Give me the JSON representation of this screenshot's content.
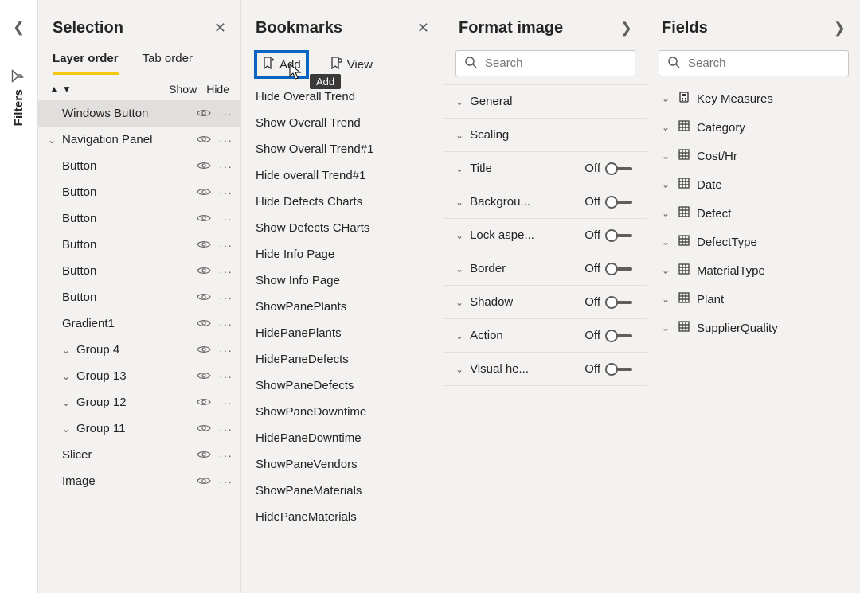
{
  "filters": {
    "label": "Filters"
  },
  "selection": {
    "title": "Selection",
    "tabs": {
      "layer": "Layer order",
      "tab": "Tab order"
    },
    "subhead": {
      "show": "Show",
      "hide": "Hide"
    },
    "items": [
      {
        "label": "Windows Button",
        "indent": 0,
        "chev": false,
        "highlight": true
      },
      {
        "label": "Navigation Panel",
        "indent": 0,
        "chev": true
      },
      {
        "label": "Button",
        "indent": 0,
        "chev": false
      },
      {
        "label": "Button",
        "indent": 0,
        "chev": false
      },
      {
        "label": "Button",
        "indent": 0,
        "chev": false
      },
      {
        "label": "Button",
        "indent": 0,
        "chev": false
      },
      {
        "label": "Button",
        "indent": 0,
        "chev": false
      },
      {
        "label": "Button",
        "indent": 0,
        "chev": false
      },
      {
        "label": "Gradient1",
        "indent": 0,
        "chev": false
      },
      {
        "label": "Group 4",
        "indent": 0,
        "chev": true,
        "indent1": true
      },
      {
        "label": "Group 13",
        "indent": 0,
        "chev": true,
        "indent1": true
      },
      {
        "label": "Group 12",
        "indent": 0,
        "chev": true,
        "indent1": true
      },
      {
        "label": "Group 11",
        "indent": 0,
        "chev": true,
        "indent1": true
      },
      {
        "label": "Slicer",
        "indent": 0,
        "chev": false
      },
      {
        "label": "Image",
        "indent": 0,
        "chev": false
      }
    ]
  },
  "bookmarks": {
    "title": "Bookmarks",
    "add": "Add",
    "view": "View",
    "tooltip": "Add",
    "items": [
      "Hide Overall Trend",
      "Show Overall Trend",
      "Show Overall Trend#1",
      "Hide overall Trend#1",
      "Hide Defects Charts",
      "Show Defects CHarts",
      "Hide Info Page",
      "Show Info Page",
      "ShowPanePlants",
      "HidePanePlants",
      "HidePaneDefects",
      "ShowPaneDefects",
      "ShowPaneDowntime",
      "HidePaneDowntime",
      "ShowPaneVendors",
      "ShowPaneMaterials",
      "HidePaneMaterials"
    ]
  },
  "format": {
    "title": "Format image",
    "search_placeholder": "Search",
    "rows": [
      {
        "name": "General",
        "toggle": null
      },
      {
        "name": "Scaling",
        "toggle": null
      },
      {
        "name": "Title",
        "toggle": "Off"
      },
      {
        "name": "Backgrou...",
        "toggle": "Off"
      },
      {
        "name": "Lock aspe...",
        "toggle": "Off"
      },
      {
        "name": "Border",
        "toggle": "Off"
      },
      {
        "name": "Shadow",
        "toggle": "Off"
      },
      {
        "name": "Action",
        "toggle": "Off"
      },
      {
        "name": "Visual he...",
        "toggle": "Off"
      }
    ]
  },
  "fields": {
    "title": "Fields",
    "search_placeholder": "Search",
    "items": [
      {
        "label": "Key Measures",
        "icon": "measure"
      },
      {
        "label": "Category",
        "icon": "table"
      },
      {
        "label": "Cost/Hr",
        "icon": "table"
      },
      {
        "label": "Date",
        "icon": "table"
      },
      {
        "label": "Defect",
        "icon": "table"
      },
      {
        "label": "DefectType",
        "icon": "table"
      },
      {
        "label": "MaterialType",
        "icon": "table"
      },
      {
        "label": "Plant",
        "icon": "table"
      },
      {
        "label": "SupplierQuality",
        "icon": "table"
      }
    ]
  }
}
